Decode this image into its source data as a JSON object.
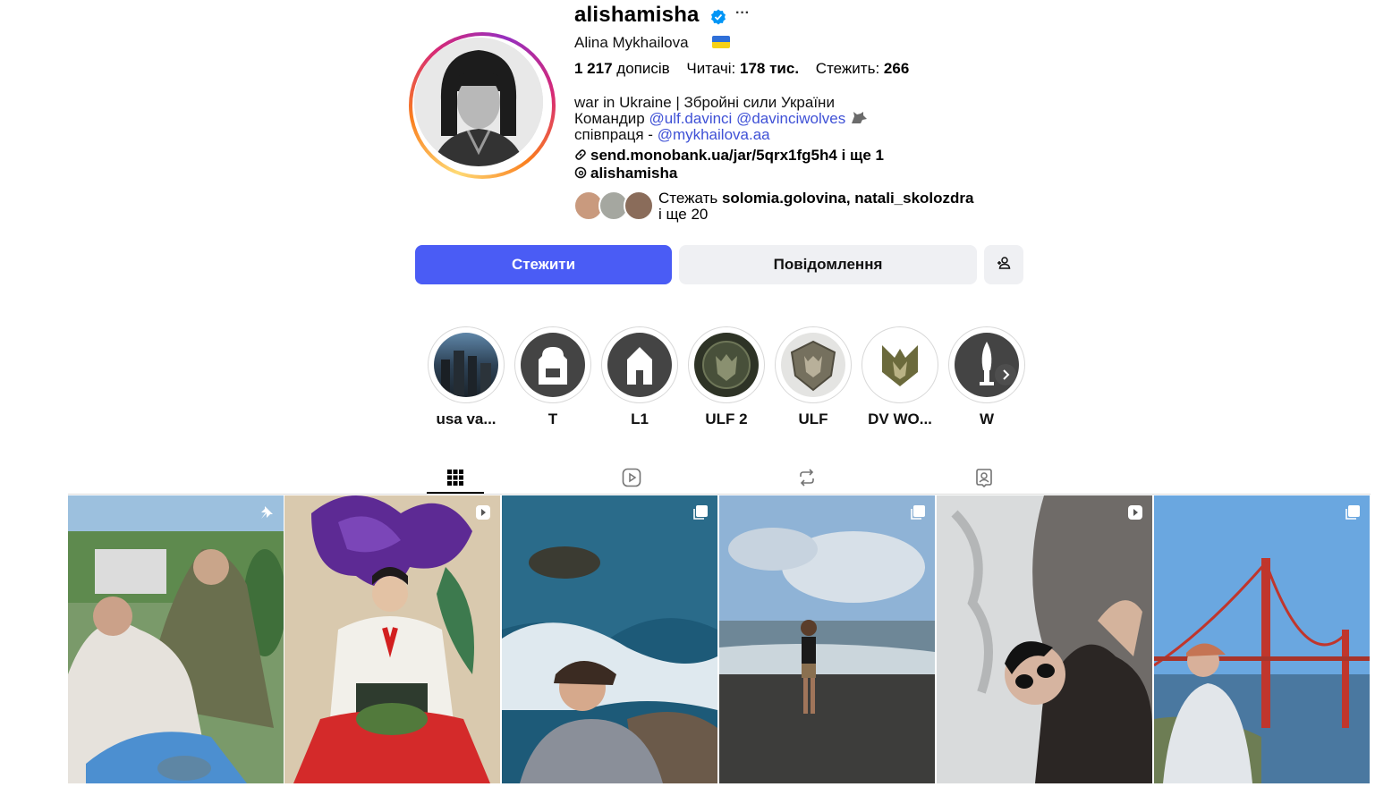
{
  "profile": {
    "username": "alishamisha",
    "full_name": "Alina Mykhailova",
    "stats": {
      "posts_value": "1 217",
      "posts_label": "дописів",
      "followers_label": "Читачі:",
      "followers_value": "178 тис.",
      "following_label": "Стежить:",
      "following_value": "266"
    },
    "bio": {
      "line1": "war in Ukraine | Збройні сили України",
      "line2_prefix": "Командир ",
      "mention1": "@ulf.davinci",
      "mention2": "@davinciwolves",
      "line3_prefix": "співпраця - ",
      "mention3": "@mykhailova.aa",
      "external_link": "send.monobank.ua/jar/5qrx1fg5h4 і ще 1",
      "threads_handle": "alishamisha"
    },
    "followed_by": {
      "prefix": "Стежать ",
      "names": "solomia.golovina, natali_skolozdra",
      "suffix": "і ще 20"
    }
  },
  "actions": {
    "follow_label": "Стежити",
    "message_label": "Повідомлення"
  },
  "highlights": [
    {
      "label": "usa va..."
    },
    {
      "label": "T"
    },
    {
      "label": "L1"
    },
    {
      "label": "ULF 2"
    },
    {
      "label": "ULF"
    },
    {
      "label": "DV WO..."
    },
    {
      "label": "W"
    }
  ],
  "tabs": [
    {
      "name": "posts",
      "icon": "grid-icon",
      "active": true
    },
    {
      "name": "reels",
      "icon": "reels-icon",
      "active": false
    },
    {
      "name": "reposts",
      "icon": "repost-icon",
      "active": false
    },
    {
      "name": "tagged",
      "icon": "tagged-icon",
      "active": false
    }
  ],
  "posts": [
    {
      "badge": "pin-icon"
    },
    {
      "badge": "reel-icon"
    },
    {
      "badge": "carousel-icon"
    },
    {
      "badge": "carousel-icon"
    },
    {
      "badge": "reel-icon"
    },
    {
      "badge": "carousel-icon"
    }
  ],
  "colors": {
    "accent": "#4a5cf5",
    "link": "#3f51d6",
    "verified": "#0095f6"
  }
}
